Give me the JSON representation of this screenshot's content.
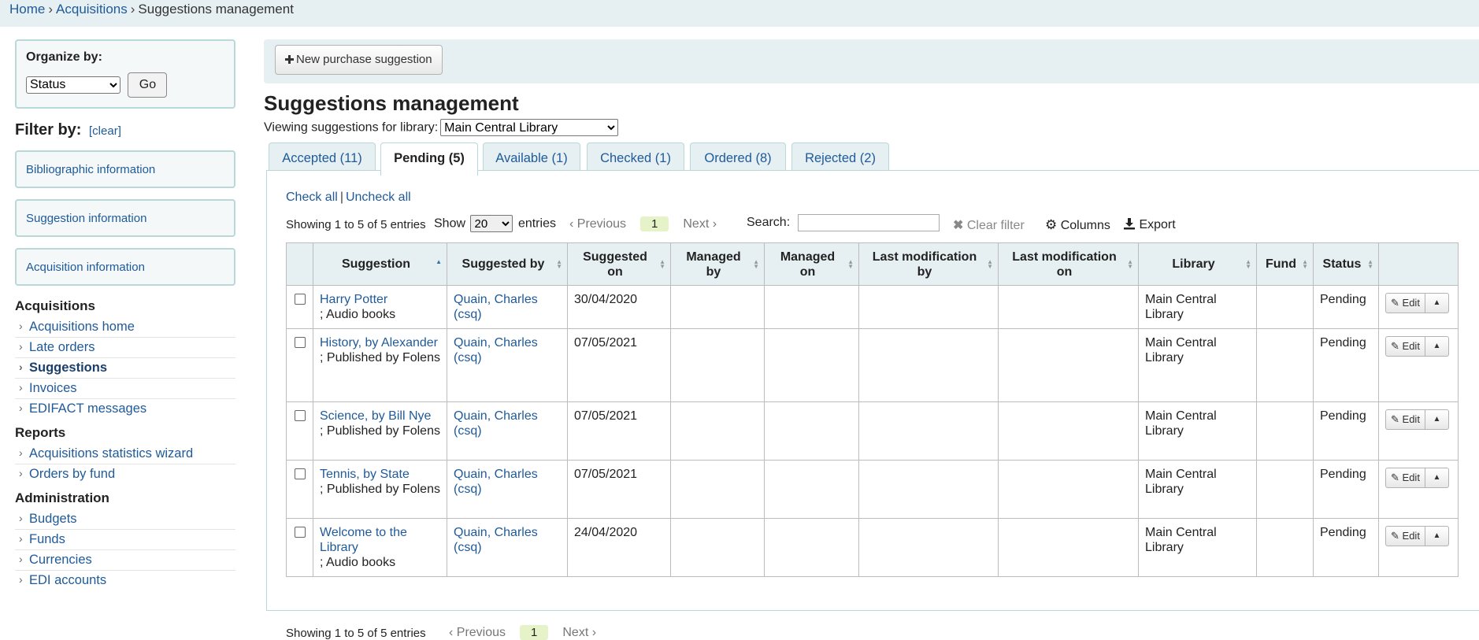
{
  "breadcrumb": {
    "home": "Home",
    "acquisitions": "Acquisitions",
    "current": "Suggestions management",
    "separator": "›"
  },
  "sidebar": {
    "organize_label": "Organize by:",
    "organize_value": "Status",
    "go_label": "Go",
    "filter_label": "Filter by:",
    "filter_clear": "[clear]",
    "filter_boxes": [
      "Bibliographic information",
      "Suggestion information",
      "Acquisition information"
    ],
    "sections": [
      {
        "title": "Acquisitions",
        "items": [
          "Acquisitions home",
          "Late orders",
          "Suggestions",
          "Invoices",
          "EDIFACT messages"
        ]
      },
      {
        "title": "Reports",
        "items": [
          "Acquisitions statistics wizard",
          "Orders by fund"
        ]
      },
      {
        "title": "Administration",
        "items": [
          "Budgets",
          "Funds",
          "Currencies",
          "EDI accounts"
        ]
      }
    ]
  },
  "toolbar": {
    "new_suggestion": "New purchase suggestion",
    "new_icon": "plus-icon"
  },
  "page": {
    "title": "Suggestions management",
    "viewing_label": "Viewing suggestions for library:",
    "library_value": "Main Central Library"
  },
  "tabs": [
    "Accepted (11)",
    "Pending (5)",
    "Available (1)",
    "Checked (1)",
    "Ordered (8)",
    "Rejected (2)"
  ],
  "active_tab": "Pending (5)",
  "list": {
    "check_all": "Check all",
    "uncheck_all": "Uncheck all",
    "info": "Showing 1 to 5 of 5 entries",
    "show_label": "Show",
    "show_value": "20",
    "entries_label": "entries",
    "previous": "Previous",
    "next": "Next",
    "page": "1",
    "search_label": "Search:",
    "clear_filter": "Clear filter",
    "columns": "Columns",
    "export": "Export"
  },
  "table": {
    "headers": [
      "Suggestion",
      "Suggested by",
      "Suggested on",
      "Managed by",
      "Managed on",
      "Last modification by",
      "Last modification on",
      "Library",
      "Fund",
      "Status"
    ],
    "edit_label": "Edit",
    "rows": [
      {
        "title": "Harry Potter",
        "detail": "; Audio books",
        "suggested_by": "Quain, Charles (csq)",
        "suggested_on": "30/04/2020",
        "library": "Main Central Library",
        "status": "Pending"
      },
      {
        "title": "History, by Alexander",
        "detail": "; Published by Folens",
        "suggested_by": "Quain, Charles (csq)",
        "suggested_on": "07/05/2021",
        "library": "Main Central Library",
        "status": "Pending"
      },
      {
        "title": "Science, by Bill Nye",
        "detail": "; Published by Folens",
        "suggested_by": "Quain, Charles (csq)",
        "suggested_on": "07/05/2021",
        "library": "Main Central Library",
        "status": "Pending"
      },
      {
        "title": "Tennis, by State",
        "detail": "; Published by Folens",
        "suggested_by": "Quain, Charles (csq)",
        "suggested_on": "07/05/2021",
        "library": "Main Central Library",
        "status": "Pending"
      },
      {
        "title": "Welcome to the Library",
        "detail": "; Audio books",
        "suggested_by": "Quain, Charles (csq)",
        "suggested_on": "24/04/2020",
        "library": "Main Central Library",
        "status": "Pending"
      }
    ]
  }
}
